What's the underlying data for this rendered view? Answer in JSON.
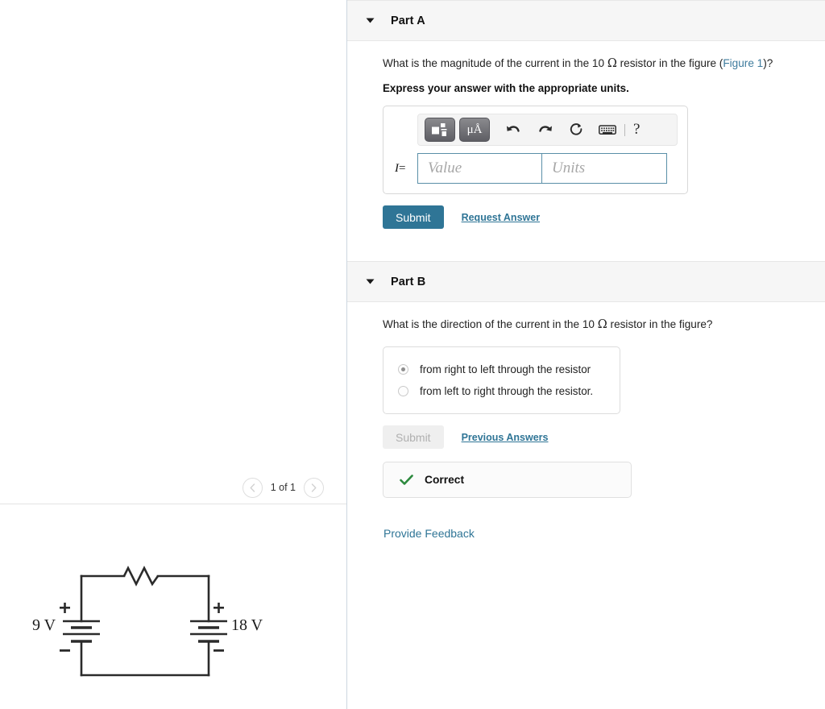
{
  "left_panel": {
    "pager": {
      "prev_icon": "chevron-left-icon",
      "next_icon": "chevron-right-icon",
      "label": "1 of 1"
    },
    "figure": {
      "name": "circuit-diagram",
      "left_battery_label": "9 V",
      "right_battery_label": "18 V",
      "left_battery_plus": "+",
      "left_battery_minus": "−",
      "right_battery_plus": "+",
      "right_battery_minus": "−"
    }
  },
  "parts": [
    {
      "id": "part-a",
      "title": "Part A",
      "collapse_icon": "caret-down-icon",
      "question_pre": "What is the magnitude of the current in the 10 ",
      "question_ohm": "Ω",
      "question_mid": " resistor in the figure (",
      "question_link": "Figure 1",
      "question_post": ")?",
      "instruction": "Express your answer with the appropriate units.",
      "toolbar": {
        "template_button": "math-template-icon",
        "units_button": "μÅ",
        "undo": "undo-icon",
        "redo": "redo-icon",
        "reset": "reset-icon",
        "keyboard": "keyboard-icon",
        "help": "?"
      },
      "answer": {
        "label_var": "I",
        "label_eq": "=",
        "value_placeholder": "Value",
        "units_placeholder": "Units",
        "value": "",
        "units": ""
      },
      "submit_label": "Submit",
      "submit_disabled": false,
      "secondary_link": "Request Answer"
    },
    {
      "id": "part-b",
      "title": "Part B",
      "collapse_icon": "caret-down-icon",
      "question_pre": "What is the direction of the current in the 10 ",
      "question_ohm": "Ω",
      "question_post": " resistor in the figure?",
      "choices": [
        {
          "label": "from right to left through the resistor",
          "selected": true
        },
        {
          "label": "from left to right through the resistor.",
          "selected": false
        }
      ],
      "submit_label": "Submit",
      "submit_disabled": true,
      "secondary_link": "Previous Answers",
      "result": {
        "icon": "check-icon",
        "text": "Correct",
        "color": "#2d8a3e"
      }
    }
  ],
  "footer": {
    "feedback_link": "Provide Feedback"
  },
  "colors": {
    "accent": "#2f7596",
    "link": "#3f7c9e",
    "header_bg": "#f6f6f6",
    "input_border": "#5a8fa8",
    "correct_green": "#2d8a3e"
  }
}
